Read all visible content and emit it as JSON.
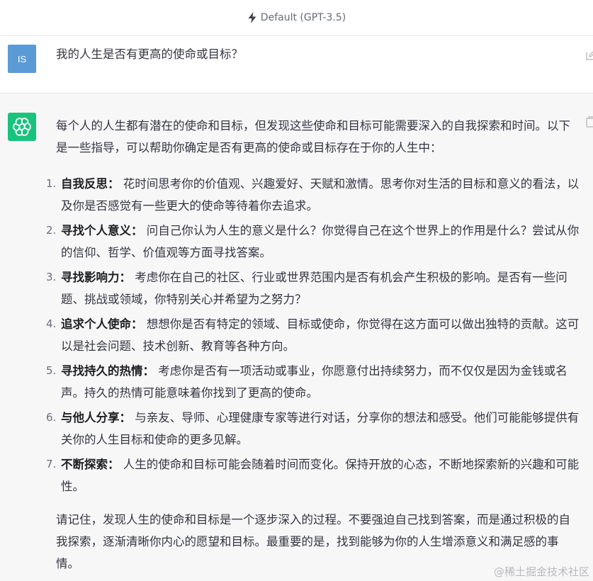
{
  "header": {
    "model_label": "Default (GPT-3.5)"
  },
  "user": {
    "avatar_initials": "IS",
    "message": "我的人生是否有更高的使命或目标？"
  },
  "assistant": {
    "intro": "每个人的人生都有潜在的使命和目标，但发现这些使命和目标可能需要深入的自我探索和时间。以下是一些指导，可以帮助你确定是否有更高的使命或目标存在于你的人生中：",
    "points": [
      {
        "num": "1.",
        "title": "自我反思：",
        "text": "花时间思考你的价值观、兴趣爱好、天赋和激情。思考你对生活的目标和意义的看法，以及你是否感觉有一些更大的使命等待着你去追求。"
      },
      {
        "num": "2.",
        "title": "寻找个人意义：",
        "text": "问自己你认为人生的意义是什么？你觉得自己在这个世界上的作用是什么？尝试从你的信仰、哲学、价值观等方面寻找答案。"
      },
      {
        "num": "3.",
        "title": "寻找影响力：",
        "text": "考虑你在自己的社区、行业或世界范围内是否有机会产生积极的影响。是否有一些问题、挑战或领域，你特别关心并希望为之努力？"
      },
      {
        "num": "4.",
        "title": "追求个人使命：",
        "text": "想想你是否有特定的领域、目标或使命，你觉得在这方面可以做出独特的贡献。这可以是社会问题、技术创新、教育等各种方向。"
      },
      {
        "num": "5.",
        "title": "寻找持久的热情：",
        "text": "考虑你是否有一项活动或事业，你愿意付出持续努力，而不仅仅是因为金钱或名声。持久的热情可能意味着你找到了更高的使命。"
      },
      {
        "num": "6.",
        "title": "与他人分享：",
        "text": "与亲友、导师、心理健康专家等进行对话，分享你的想法和感受。他们可能能够提供有关你的人生目标和使命的更多见解。"
      },
      {
        "num": "7.",
        "title": "不断探索：",
        "text": "人生的使命和目标可能会随着时间而变化。保持开放的心态，不断地探索新的兴趣和可能性。"
      }
    ],
    "closing": "请记住，发现人生的使命和目标是一个逐步深入的过程。不要强迫自己找到答案，而是通过积极的自我探索，逐渐清晰你内心的愿望和目标。最重要的是，找到能够为你的人生增添意义和满足感的事情。"
  },
  "watermark": "@稀土掘金技术社区",
  "colors": {
    "accent": "#19c37d",
    "user_avatar": "#5b9bd5",
    "assistant_bg": "#f7f7f8"
  },
  "icons": [
    "bolt-icon",
    "edit-icon",
    "openai-logo-icon",
    "copy-icon"
  ]
}
